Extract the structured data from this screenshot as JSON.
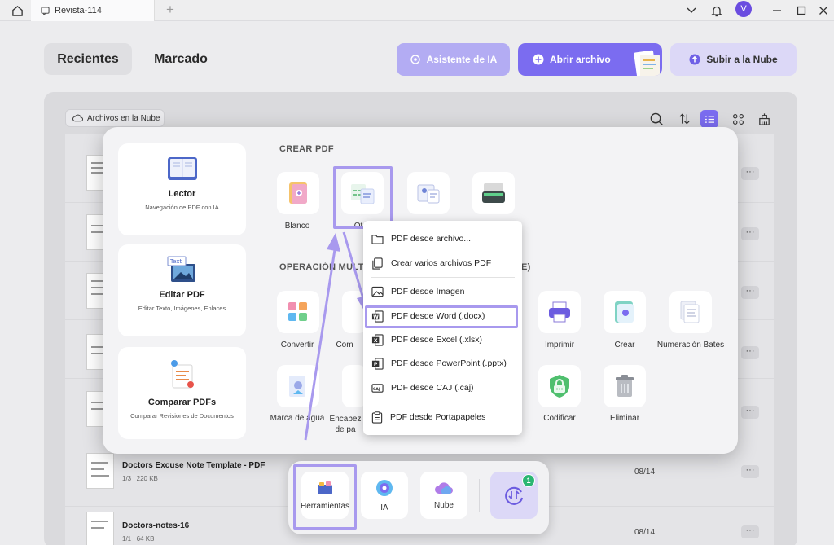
{
  "titlebar": {
    "tab_title": "Revista-114",
    "new_tab": "+",
    "avatar_letter": "V"
  },
  "header": {
    "tabs": [
      "Recientes",
      "Marcado"
    ],
    "ai_button": "Asistente de IA",
    "open_button": "Abrir archivo",
    "cloud_button": "Subir a la Nube"
  },
  "colors": {
    "accent": "#7b6cf0",
    "accent_light": "#a99ef5",
    "cloud_btn_bg": "#dcd8f7",
    "ai_btn_bg": "#b7b0f2"
  },
  "panel": {
    "cloud_chip": "Archivos en la Nube"
  },
  "files": [
    {
      "name": "Doctors Excuse Note Template - PDF",
      "meta": "1/3 | 220 KB",
      "date": "08/14"
    },
    {
      "name": "Doctors-notes-16",
      "meta": "1/1 | 64 KB",
      "date": "08/14"
    }
  ],
  "tools_overlay": {
    "left_cards": [
      {
        "title": "Lector",
        "subtitle": "Navegación de PDF con IA"
      },
      {
        "title": "Editar PDF",
        "subtitle": "Editar Texto, Imágenes, Enlaces"
      },
      {
        "title": "Comparar PDFs",
        "subtitle": "Comparar Revisiones de Documentos"
      }
    ],
    "create_section": "CREAR PDF",
    "create_tiles": [
      "Blanco",
      "Ot"
    ],
    "ops_section": "OPERACIÓN MULTI",
    "ops_section_tail": "E)",
    "ops_row1": [
      "Convertir",
      "Com",
      "Imprimir",
      "Crear",
      "Numeración Bates"
    ],
    "ops_row2": [
      "Marca de agua",
      "Encabez de pa",
      "Codificar",
      "Eliminar"
    ]
  },
  "dropdown": {
    "items": [
      "PDF desde archivo...",
      "Crear varios archivos PDF",
      "PDF desde Imagen",
      "PDF desde Word (.docx)",
      "PDF desde Excel (.xlsx)",
      "PDF desde PowerPoint (.pptx)",
      "PDF desde CAJ (.caj)",
      "PDF desde Portapapeles"
    ]
  },
  "dock": {
    "items": [
      "Herramientas",
      "IA",
      "Nube"
    ],
    "badge": "1"
  }
}
